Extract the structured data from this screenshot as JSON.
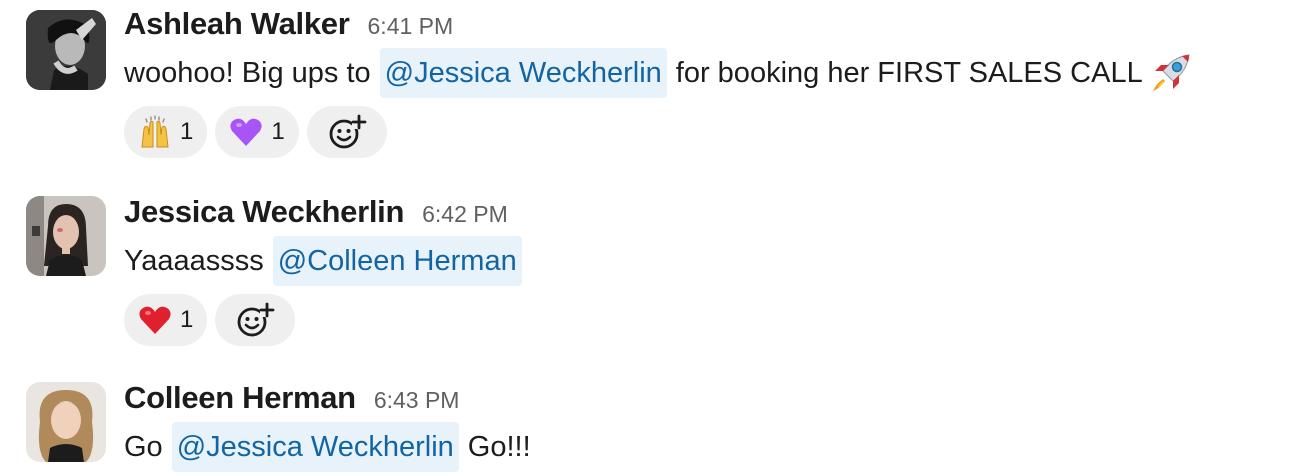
{
  "messages": [
    {
      "author": "Ashleah Walker",
      "time": "6:41 PM",
      "text_before": "woohoo! Big ups to",
      "mention": "@Jessica Weckherlin",
      "text_after": "for booking her FIRST SALES CALL",
      "trailing_emoji": "rocket",
      "reactions": [
        {
          "emoji": "raising-hands",
          "count": "1"
        },
        {
          "emoji": "purple-heart",
          "count": "1"
        }
      ]
    },
    {
      "author": "Jessica Weckherlin",
      "time": "6:42 PM",
      "text_before": "Yaaaassss",
      "mention": "@Colleen Herman",
      "reactions": [
        {
          "emoji": "red-heart",
          "count": "1"
        }
      ]
    },
    {
      "author": "Colleen Herman",
      "time": "6:43 PM",
      "text_before": "Go",
      "mention": "@Jessica Weckherlin",
      "text_after": "Go!!!"
    }
  ],
  "colors": {
    "mention_bg": "#e8f2fa",
    "mention_text": "#1264a3",
    "reaction_bg": "#efefef",
    "timestamp": "#616061"
  }
}
